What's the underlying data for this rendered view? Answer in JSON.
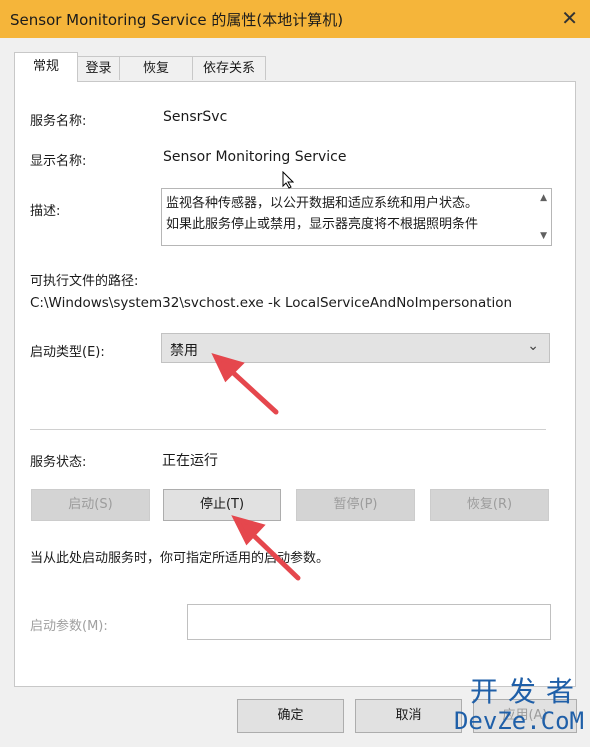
{
  "window": {
    "title": "Sensor Monitoring Service 的属性(本地计算机)",
    "close_glyph": "✕"
  },
  "tabs": [
    "常规",
    "登录",
    "恢复",
    "依存关系"
  ],
  "general": {
    "service_name_label": "服务名称:",
    "service_name": "SensrSvc",
    "display_name_label": "显示名称:",
    "display_name": "Sensor Monitoring Service",
    "description_label": "描述:",
    "description_line1": "监视各种传感器，以公开数据和适应系统和用户状态。",
    "description_line2": "如果此服务停止或禁用，显示器亮度将不根据照明条件",
    "path_label": "可执行文件的路径:",
    "path": "C:\\Windows\\system32\\svchost.exe -k LocalServiceAndNoImpersonation",
    "startup_type_label": "启动类型(E):",
    "startup_type": "禁用",
    "status_label": "服务状态:",
    "status": "正在运行"
  },
  "service_buttons": {
    "start": "启动(S)",
    "stop": "停止(T)",
    "pause": "暂停(P)",
    "resume": "恢复(R)"
  },
  "hint": "当从此处启动服务时，你可指定所适用的启动参数。",
  "param_label": "启动参数(M):",
  "param_value": "",
  "dialog_buttons": {
    "ok": "确定",
    "cancel": "取消",
    "apply": "应用(A)"
  },
  "watermark": {
    "line1": "开发者",
    "line2": "DevZe.CoM"
  },
  "colors": {
    "titlebar": "#f5b53a",
    "arrow": "#e5474d",
    "watermark": "#1f5fa8"
  }
}
